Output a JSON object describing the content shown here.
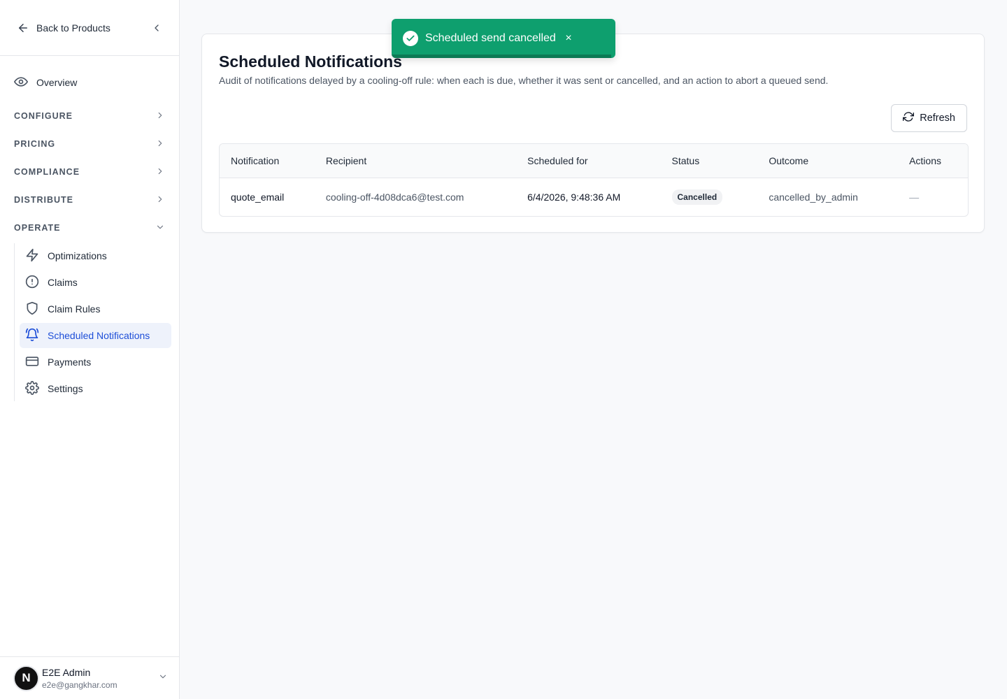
{
  "sidebar": {
    "back_label": "Back to Products",
    "overview_label": "Overview",
    "sections": [
      {
        "label": "CONFIGURE"
      },
      {
        "label": "PRICING"
      },
      {
        "label": "COMPLIANCE"
      },
      {
        "label": "DISTRIBUTE"
      },
      {
        "label": "OPERATE"
      }
    ],
    "operate_items": [
      {
        "label": "Optimizations",
        "icon": "lightning-icon"
      },
      {
        "label": "Claims",
        "icon": "alert-circle-icon"
      },
      {
        "label": "Claim Rules",
        "icon": "shield-icon"
      },
      {
        "label": "Scheduled Notifications",
        "icon": "bell-icon",
        "active": true
      },
      {
        "label": "Payments",
        "icon": "credit-card-icon"
      },
      {
        "label": "Settings",
        "icon": "gear-icon"
      }
    ],
    "user": {
      "initial": "N",
      "name": "E2E Admin",
      "email": "e2e@gangkhar.com"
    }
  },
  "main": {
    "title": "Scheduled Notifications",
    "description": "Audit of notifications delayed by a cooling-off rule: when each is due, whether it was sent or cancelled, and an action to abort a queued send.",
    "refresh_label": "Refresh",
    "table": {
      "columns": [
        "Notification",
        "Recipient",
        "Scheduled for",
        "Status",
        "Outcome",
        "Actions"
      ],
      "rows": [
        {
          "notification": "quote_email",
          "recipient": "cooling-off-4d08dca6@test.com",
          "scheduled_for": "6/4/2026, 9:48:36 AM",
          "status": "Cancelled",
          "outcome": "cancelled_by_admin",
          "actions": "—"
        }
      ]
    }
  },
  "toast": {
    "message": "Scheduled send cancelled",
    "close_glyph": "×",
    "progress": 0.98
  },
  "colors": {
    "accent": "#1d4ed8",
    "toast_bg": "#0e9f6e",
    "active_bg": "#eef2fb"
  }
}
